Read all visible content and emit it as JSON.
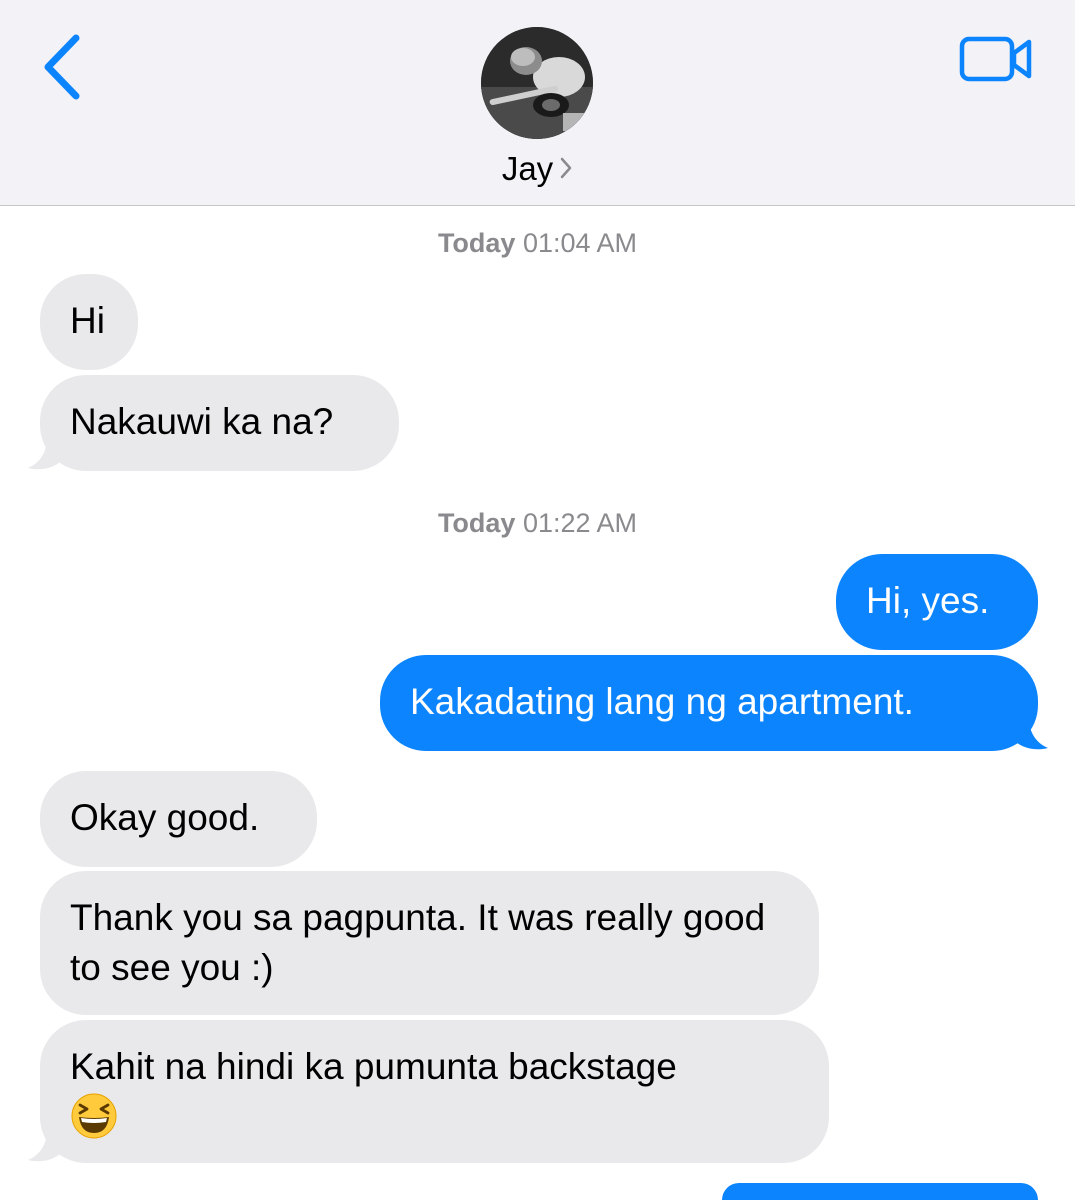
{
  "header": {
    "contact_name": "Jay",
    "back_icon": "chevron-left-icon",
    "video_icon": "video-camera-icon",
    "accent_color": "#0b84fe"
  },
  "conversation": {
    "timestamps": [
      {
        "day": "Today",
        "time": "01:04 AM"
      },
      {
        "day": "Today",
        "time": "01:22 AM"
      }
    ],
    "messages": [
      {
        "sender": "them",
        "text": "Hi"
      },
      {
        "sender": "them",
        "text": "Nakauwi ka na?"
      },
      {
        "sender": "me",
        "text": "Hi, yes."
      },
      {
        "sender": "me",
        "text": "Kakadating lang ng apartment."
      },
      {
        "sender": "them",
        "text": "Okay good."
      },
      {
        "sender": "them",
        "text": "Thank you sa pagpunta. It was really good to see you :)"
      },
      {
        "sender": "them",
        "text": "Kahit na hindi ka pumunta backstage",
        "emoji": "grinning-squinting-face"
      }
    ]
  },
  "colors": {
    "incoming_bubble": "#e9e9eb",
    "outgoing_bubble": "#0b84fe",
    "header_bg": "#f2f2f7",
    "timestamp_text": "#8a8a8e"
  }
}
